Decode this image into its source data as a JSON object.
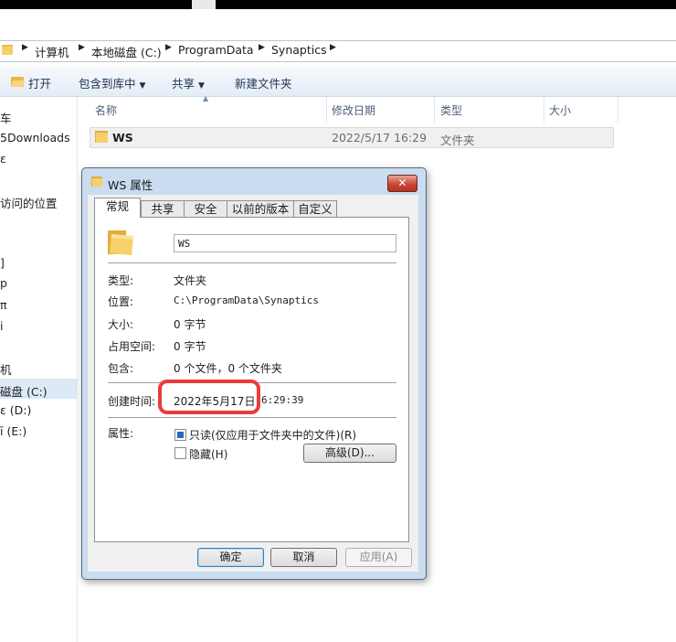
{
  "address": {
    "crumbs": [
      "计算机",
      "本地磁盘 (C:)",
      "ProgramData",
      "Synaptics"
    ]
  },
  "toolbar": {
    "open_label": "打开",
    "include_label": "包含到库中",
    "share_label": "共享",
    "new_folder_label": "新建文件夹"
  },
  "nav": {
    "items": [
      "车",
      "5Downloads",
      "ɛ",
      "访问的位置",
      "]",
      "p",
      "π",
      "i",
      "机",
      "磁盘 (C:)",
      "ɛ (D:)",
      "ī (E:)"
    ]
  },
  "columns": {
    "name": "名称",
    "date": "修改日期",
    "type": "类型",
    "size": "大小"
  },
  "file": {
    "name": "WS",
    "date": "2022/5/17 16:29",
    "type": "文件夹"
  },
  "dialog": {
    "title": "WS 属性",
    "close": "✕",
    "tabs": [
      "常规",
      "共享",
      "安全",
      "以前的版本",
      "自定义"
    ],
    "name_value": "WS",
    "props": {
      "type_label": "类型:",
      "type_value": "文件夹",
      "location_label": "位置:",
      "location_value": "C:\\ProgramData\\Synaptics",
      "size_label": "大小:",
      "size_value": "0 字节",
      "disk_label": "占用空间:",
      "disk_value": "0 字节",
      "contains_label": "包含:",
      "contains_value": "0 个文件，0 个文件夹",
      "created_label": "创建时间:",
      "created_value": "2022年5月17日，",
      "created_time": "6:29:39",
      "attrs_label": "属性:",
      "readonly_label": "只读(仅应用于文件夹中的文件)(R)",
      "hidden_label": "隐藏(H)",
      "advanced_label": "高级(D)..."
    },
    "buttons": {
      "ok": "确定",
      "cancel": "取消",
      "apply": "应用(A)"
    }
  },
  "colors": {
    "highlight": "#ec3b3b",
    "dialog_frame": "#c9dcf0",
    "close_button": "#c9483a"
  }
}
